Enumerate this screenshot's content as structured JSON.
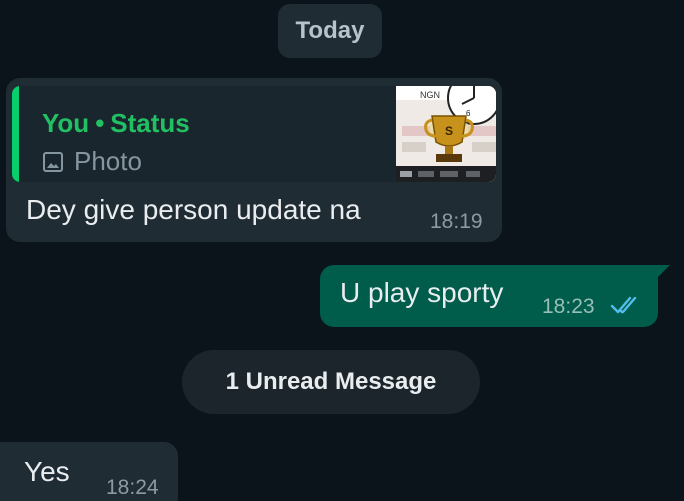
{
  "date_separator": "Today",
  "messages": [
    {
      "direction": "incoming",
      "quoted": {
        "author": "You",
        "separator": "•",
        "source": "Status",
        "media_type": "Photo",
        "media_icon": "image-icon",
        "thumbnail": {
          "banner_text": "NGN",
          "trophy_label": "S"
        }
      },
      "text": "Dey give person update na",
      "time": "18:19"
    },
    {
      "direction": "outgoing",
      "text": "U play sporty",
      "time": "18:23",
      "status_icon": "double-check-read-icon"
    },
    {
      "direction": "incoming",
      "text": "Yes",
      "time": "18:24"
    }
  ],
  "unread_divider": "1 Unread Message",
  "colors": {
    "background": "#0b141a",
    "incoming_bubble": "#202c33",
    "outgoing_bubble": "#005c4b",
    "quote_accent": "#06cf6c",
    "quote_author": "#21c063",
    "read_ticks": "#53bdeb"
  }
}
